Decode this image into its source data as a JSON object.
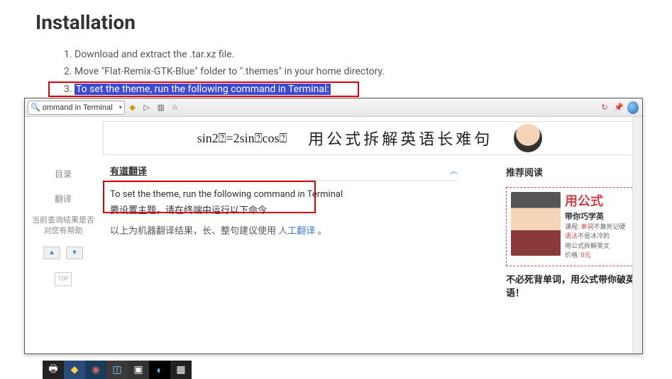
{
  "page": {
    "title": "Installation",
    "steps": [
      "Download and extract the .tar.xz file.",
      "Move \"Flat-Remix-GTK-Blue\" folder to \".themes\" in your home directory.",
      "To set the theme, run the following command in Terminal:"
    ]
  },
  "dict": {
    "search_value": "ommand in Terminal",
    "banner_formula": "sin2⍰=2sin⍰cos⍰",
    "banner_cn": "用公式拆解英语长难句",
    "sidebar": {
      "tab_toc": "目录",
      "tab_trans": "翻译",
      "help_text": "当前查询结果是否对您有帮助",
      "top_label": "TOP"
    },
    "section_title": "有道翻译",
    "translation": {
      "en": "To set the theme, run the following command in Terminal",
      "cn": "要设置主题，请在终端中运行以下命令",
      "note_prefix": "以上为机器翻译结果，长、整句建议使用 ",
      "note_link": "人工翻译",
      "note_suffix": " 。"
    },
    "right": {
      "title": "推荐阅读",
      "ad_headline": "用公式",
      "ad_sub": "带你巧学英",
      "ad_line1_a": "课程: ",
      "ad_line1_b": "单词",
      "ad_line1_c": "不靠死记硬",
      "ad_line2_a": "语法",
      "ad_line2_b": "不是冰冷的",
      "ad_line3": "用公式拆解英文",
      "ad_price_label": "价格: ",
      "ad_price": "0元",
      "caption": "不必死背单词，用公式带你破英语！"
    }
  }
}
